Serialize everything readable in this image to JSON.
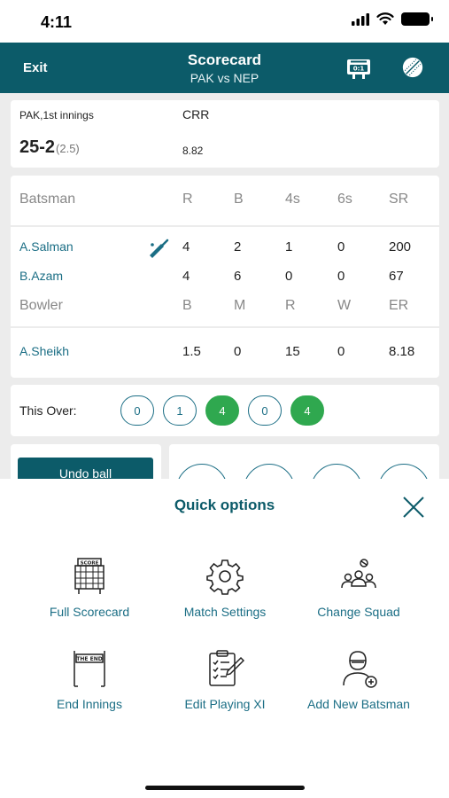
{
  "status_bar": {
    "time": "4:11"
  },
  "header": {
    "exit_label": "Exit",
    "title": "Scorecard",
    "subtitle": "PAK vs NEP"
  },
  "summary": {
    "innings_label": "PAK,1st innings",
    "score": "25-2",
    "overs": "(2.5)",
    "crr_label": "CRR",
    "crr_value": "8.82"
  },
  "batting": {
    "headers": [
      "Batsman",
      "R",
      "B",
      "4s",
      "6s",
      "SR"
    ],
    "rows": [
      {
        "name": "A.Salman",
        "r": "4",
        "b": "2",
        "fours": "1",
        "sixes": "0",
        "sr": "200",
        "on_strike": true
      },
      {
        "name": "B.Azam",
        "r": "4",
        "b": "6",
        "fours": "0",
        "sixes": "0",
        "sr": "67",
        "on_strike": false
      }
    ]
  },
  "bowling": {
    "headers": [
      "Bowler",
      "B",
      "M",
      "R",
      "W",
      "ER"
    ],
    "rows": [
      {
        "name": "A.Sheikh",
        "b": "1.5",
        "m": "0",
        "r": "15",
        "w": "0",
        "er": "8.18"
      }
    ]
  },
  "this_over": {
    "label": "This Over:",
    "balls": [
      "0",
      "1",
      "4",
      "0",
      "4"
    ]
  },
  "actions": {
    "undo_label": "Undo ball"
  },
  "quick_options": {
    "title": "Quick options",
    "items": [
      {
        "label": "Full Scorecard",
        "icon": "scorecard-board-icon"
      },
      {
        "label": "Match Settings",
        "icon": "gear-icon"
      },
      {
        "label": "Change Squad",
        "icon": "team-icon"
      },
      {
        "label": "End Innings",
        "icon": "end-banner-icon"
      },
      {
        "label": "Edit Playing XI",
        "icon": "clipboard-edit-icon"
      },
      {
        "label": "Add New Batsman",
        "icon": "add-batsman-icon"
      }
    ]
  },
  "colors": {
    "primary": "#0c5b69",
    "link": "#1b6e85",
    "boundary": "#2fa84f"
  }
}
